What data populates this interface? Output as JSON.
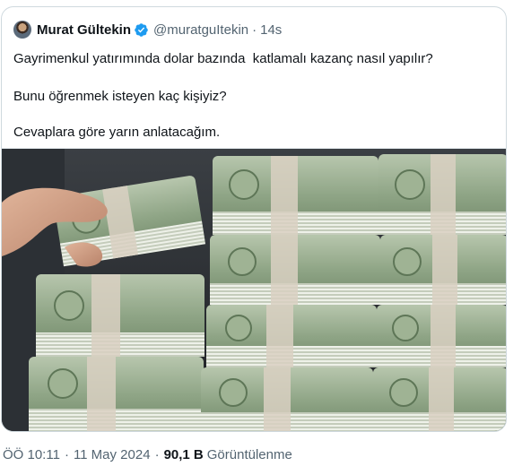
{
  "tweet": {
    "display_name": "Murat Gültekin",
    "handle": "@muratguItekin",
    "separator": "·",
    "time_ago": "14s",
    "verified_icon": "verified-badge-icon",
    "text_lines": [
      "Gayrimenkul yatırımında dolar bazında  katlamalı kazanç nasıl yapılır?",
      "Bunu öğrenmek isteyen kaç kişiyiz?",
      "Cevaplara göre yarın anlatacağım."
    ],
    "media_description_icon": "photo-dollar-stacks"
  },
  "meta": {
    "time": "ÖÖ 10:11",
    "separator": "·",
    "date": "11 May 2024",
    "views_count": "90,1 B",
    "views_label": "Görüntülenme"
  },
  "colors": {
    "accent": "#1d9bf0",
    "text": "#0f1419",
    "muted": "#536471",
    "border": "#cfd9de",
    "money_green": "#7f9a78",
    "band": "#d9c9b7"
  }
}
